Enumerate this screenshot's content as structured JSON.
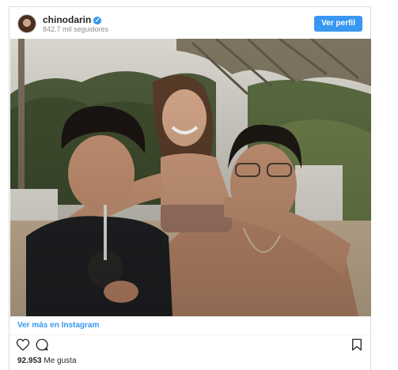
{
  "post": {
    "username": "chinodarin",
    "verified_glyph": "✓",
    "followers": "842.7 mil seguidores",
    "profile_button": "Ver perfil",
    "view_more": "Ver más en Instagram",
    "likes_number": "92.953",
    "likes_label": "Me gusta"
  },
  "icons": {
    "avatar": "profile-photo",
    "verified": "verified-badge-icon",
    "like": "heart-icon",
    "comment": "comment-bubble-icon",
    "save": "bookmark-icon"
  },
  "colors": {
    "accent": "#3897f0",
    "text": "#262626",
    "muted": "#8e8e8e",
    "border": "#dbdbdb"
  }
}
